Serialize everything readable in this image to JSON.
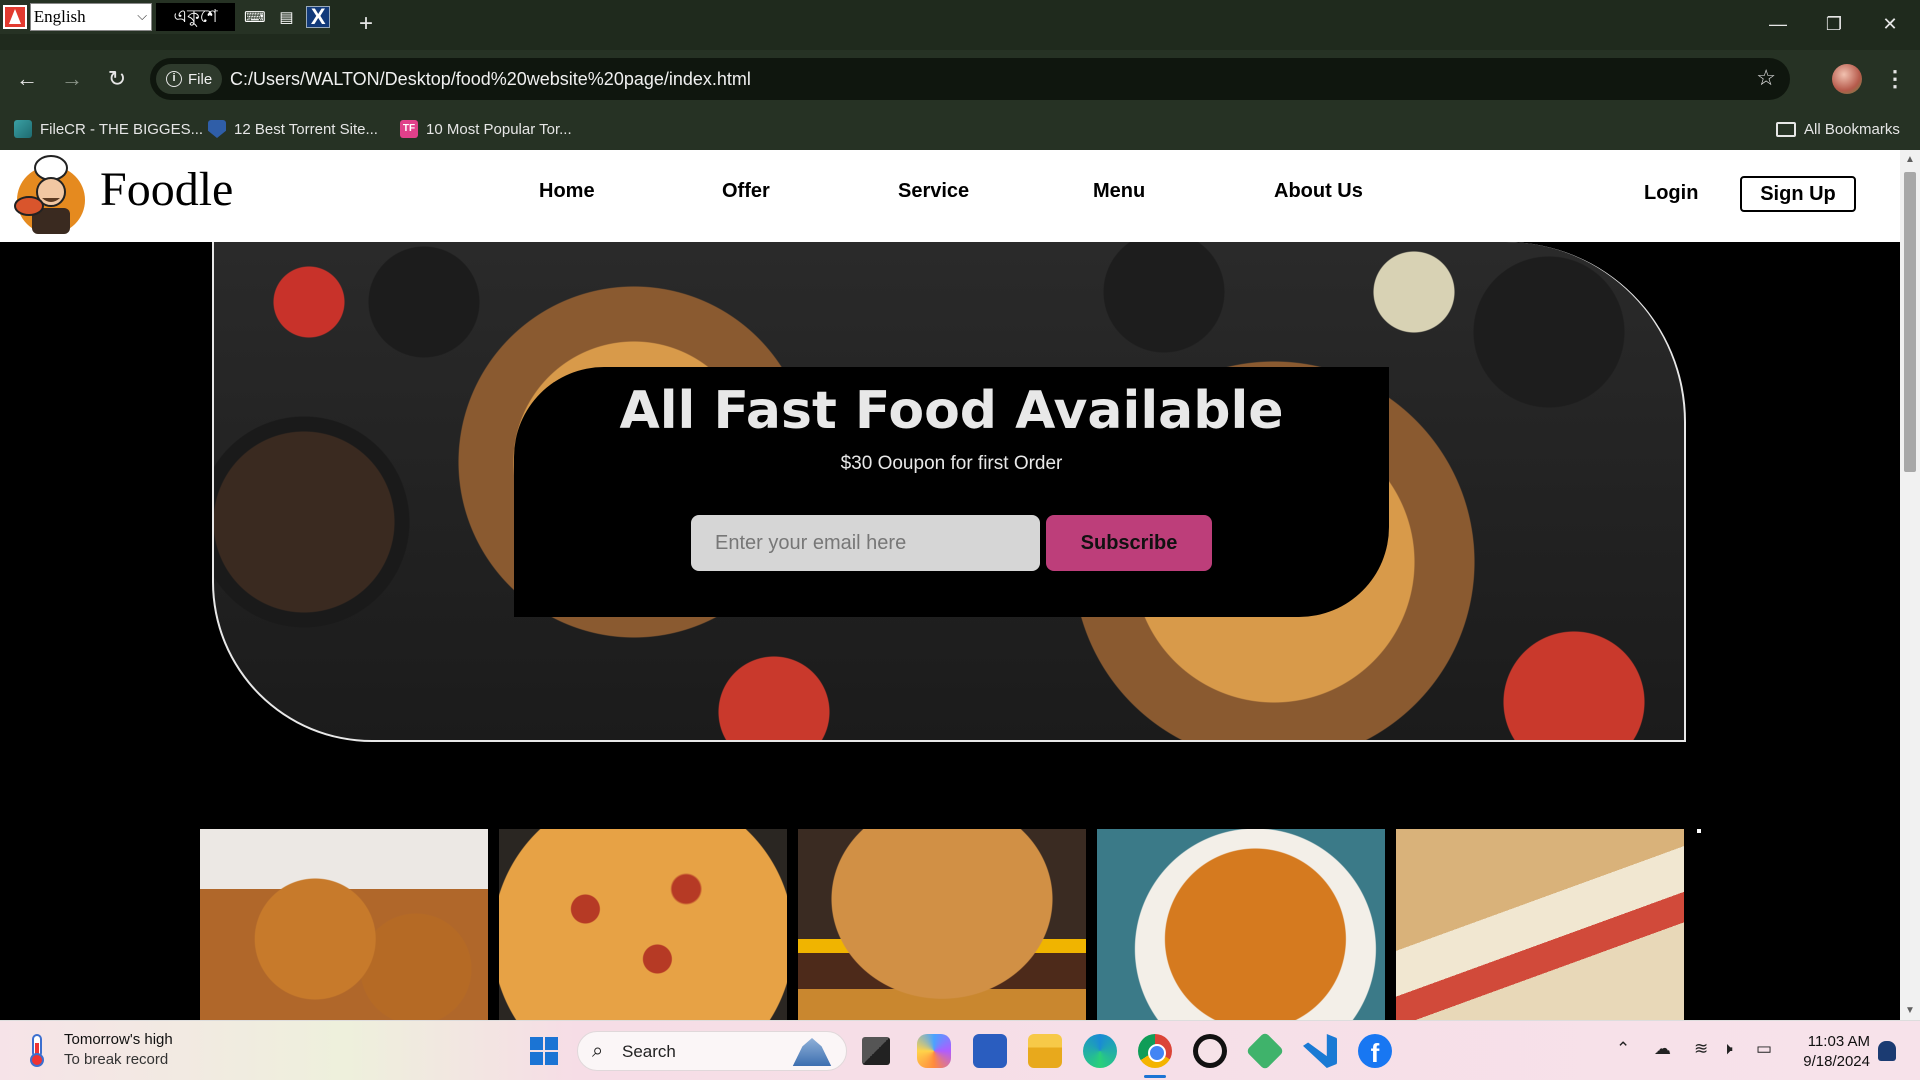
{
  "browser": {
    "ime": {
      "language": "English",
      "bengali": "একুশে",
      "x_label": "X"
    },
    "new_tab": "+",
    "window": {
      "minimize": "—",
      "restore": "❐",
      "close": "✕"
    },
    "nav": {
      "back": "←",
      "forward": "→",
      "reload": "↻"
    },
    "file_chip": "File",
    "url": "C:/Users/WALTON/Desktop/food%20website%20page/index.html",
    "star": "☆",
    "menu": "⋮",
    "bookmarks": [
      {
        "label": "FileCR - THE BIGGES...",
        "icon": "filecr-icon"
      },
      {
        "label": "12 Best Torrent Site...",
        "icon": "shield-icon"
      },
      {
        "label": "10 Most Popular Tor...",
        "icon": "tf-icon",
        "icon_text": "TF"
      }
    ],
    "all_bookmarks": "All Bookmarks"
  },
  "site": {
    "brand": "Foodle",
    "nav_links": [
      "Home",
      "Offer",
      "Service",
      "Menu",
      "About Us"
    ],
    "login": "Login",
    "signup": "Sign Up",
    "hero": {
      "title": "All Fast Food Available",
      "subtitle": "$30 Ooupon for first Order",
      "email_placeholder": "Enter your email here",
      "subscribe": "Subscribe"
    },
    "food_tiles": [
      "fried-chicken",
      "pizza",
      "burger",
      "noodles",
      "sandwich"
    ]
  },
  "taskbar": {
    "weather_title": "Tomorrow's high",
    "weather_sub": "To break record",
    "search": "Search",
    "tray": {
      "chevron": "⌃",
      "cloud": "☁",
      "wifi": "≋",
      "volume": "🕨",
      "battery": "▭"
    },
    "time": "11:03 AM",
    "date": "9/18/2024"
  },
  "colors": {
    "chrome_bg": "#263224",
    "page_bg": "#000000",
    "subscribe_bg": "#bd3e7a",
    "input_bg": "#d6d6d6"
  }
}
